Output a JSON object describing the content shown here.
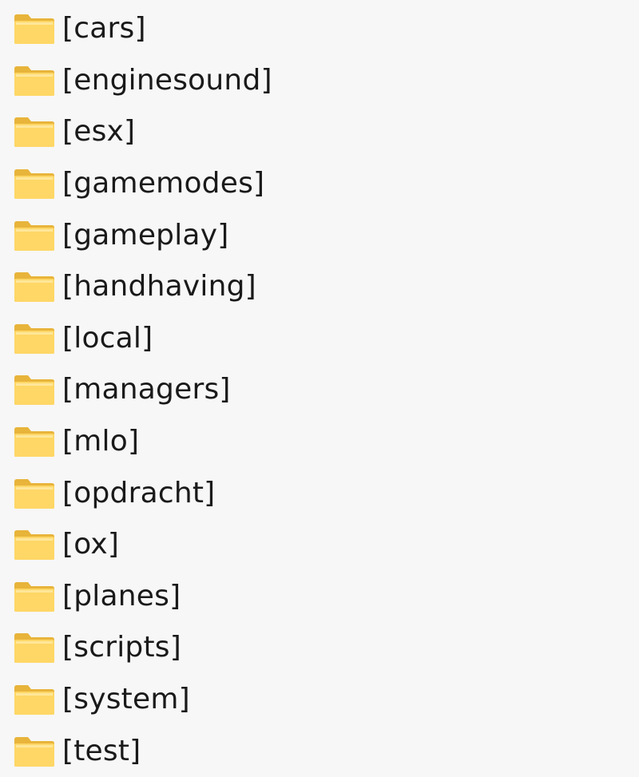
{
  "folders": [
    {
      "name": "[cars]"
    },
    {
      "name": "[enginesound]"
    },
    {
      "name": "[esx]"
    },
    {
      "name": "[gamemodes]"
    },
    {
      "name": "[gameplay]"
    },
    {
      "name": "[handhaving]"
    },
    {
      "name": "[local]"
    },
    {
      "name": "[managers]"
    },
    {
      "name": "[mlo]"
    },
    {
      "name": "[opdracht]"
    },
    {
      "name": "[ox]"
    },
    {
      "name": "[planes]"
    },
    {
      "name": "[scripts]"
    },
    {
      "name": "[system]"
    },
    {
      "name": "[test]"
    }
  ],
  "colors": {
    "folder_back": "#e8b43a",
    "folder_front": "#ffd766",
    "folder_highlight": "#ffe79a",
    "text": "#1a1a1a",
    "background": "#f7f7f7"
  },
  "icon": "folder-icon"
}
